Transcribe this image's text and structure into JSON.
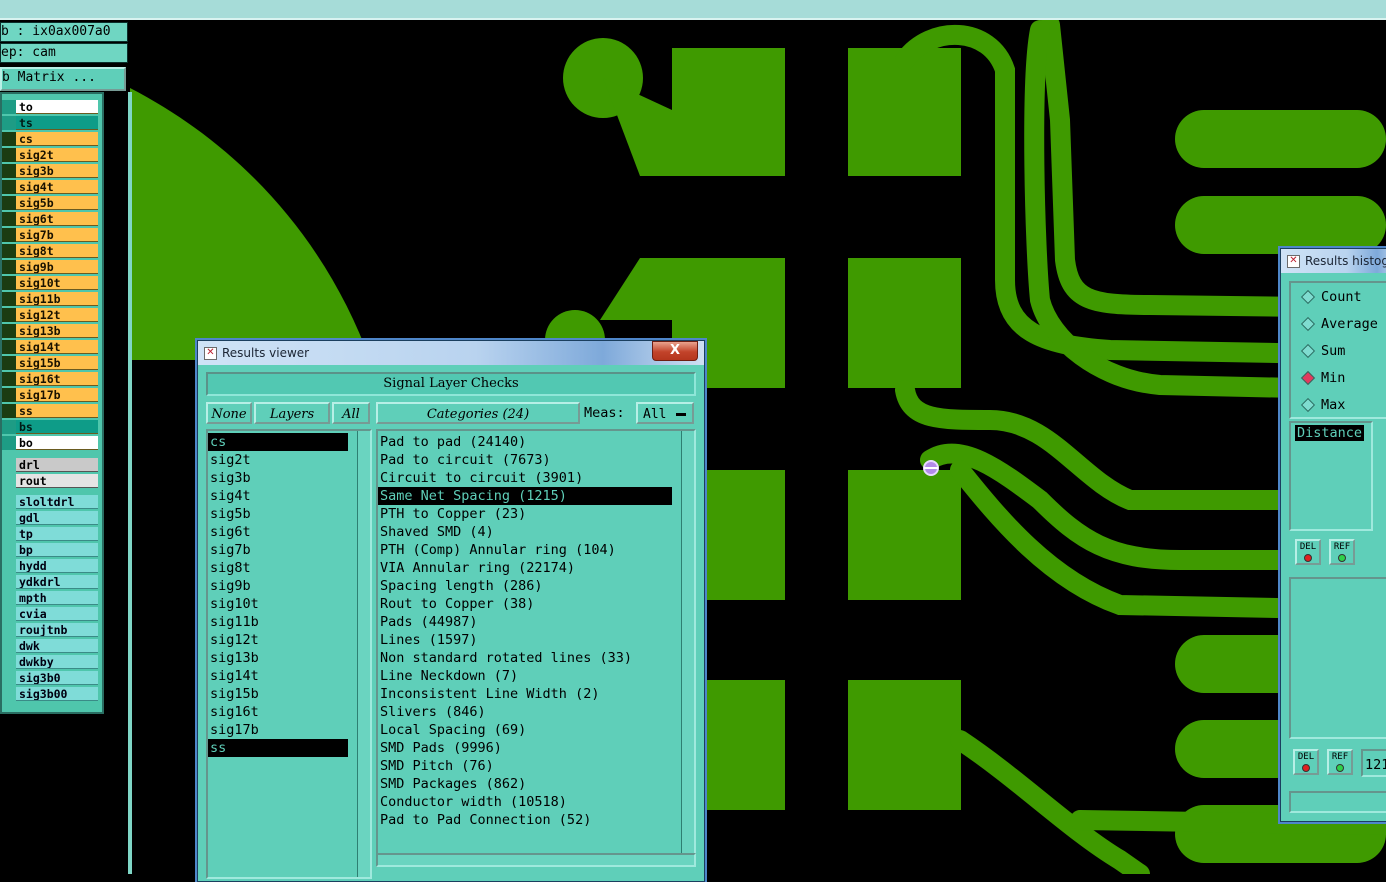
{
  "left_panel": {
    "job": "b : ix0ax007a0",
    "step": "ep: cam",
    "matrix_button": "b Matrix ...",
    "layers": [
      {
        "name": "to",
        "kind": "white",
        "mark": "◂"
      },
      {
        "name": "ts",
        "kind": "teal",
        "mark": ""
      },
      {
        "name": "cs",
        "kind": "orange",
        "mark": "▫"
      },
      {
        "name": "sig2t",
        "kind": "orange",
        "mark": ""
      },
      {
        "name": "sig3b",
        "kind": "orange",
        "mark": ""
      },
      {
        "name": "sig4t",
        "kind": "orange",
        "mark": ""
      },
      {
        "name": "sig5b",
        "kind": "orange",
        "mark": ""
      },
      {
        "name": "sig6t",
        "kind": "orange",
        "mark": ""
      },
      {
        "name": "sig7b",
        "kind": "orange",
        "mark": ""
      },
      {
        "name": "sig8t",
        "kind": "orange",
        "mark": ""
      },
      {
        "name": "sig9b",
        "kind": "orange",
        "mark": ""
      },
      {
        "name": "sig10t",
        "kind": "orange",
        "mark": ""
      },
      {
        "name": "sig11b",
        "kind": "orange",
        "mark": ""
      },
      {
        "name": "sig12t",
        "kind": "orange",
        "mark": ""
      },
      {
        "name": "sig13b",
        "kind": "orange",
        "mark": ""
      },
      {
        "name": "sig14t",
        "kind": "orange",
        "mark": ""
      },
      {
        "name": "sig15b",
        "kind": "orange",
        "mark": ""
      },
      {
        "name": "sig16t",
        "kind": "orange",
        "mark": ""
      },
      {
        "name": "sig17b",
        "kind": "orange",
        "mark": ""
      },
      {
        "name": "ss",
        "kind": "orange",
        "mark": ""
      },
      {
        "name": "bs",
        "kind": "teal",
        "mark": ""
      },
      {
        "name": "bo",
        "kind": "white",
        "mark": "◂"
      }
    ],
    "drill_layers": [
      {
        "name": "drl",
        "kind": "gray"
      },
      {
        "name": "rout",
        "kind": "gray2"
      }
    ],
    "misc_layers": [
      "sloltdrl",
      "gdl",
      "tp",
      "bp",
      "hydd",
      "ydkdrl",
      "mpth",
      "cvia",
      "roujtnb",
      "dwk",
      "dwkby",
      "sig3b0",
      "sig3b00"
    ]
  },
  "results_viewer": {
    "title": "Results viewer",
    "close": "X",
    "header": "Signal Layer Checks",
    "none_button": "None",
    "layers_button": "Layers",
    "all_button": "All",
    "categories_button": "Categories (24)",
    "meas_label": "Meas:",
    "meas_value": "All",
    "layers": [
      "cs",
      "sig2t",
      "sig3b",
      "sig4t",
      "sig5b",
      "sig6t",
      "sig7b",
      "sig8t",
      "sig9b",
      "sig10t",
      "sig11b",
      "sig12t",
      "sig13b",
      "sig14t",
      "sig15b",
      "sig16t",
      "sig17b",
      "ss"
    ],
    "selected_layers": [
      "cs",
      "ss"
    ],
    "categories": [
      "Pad to pad (24140)",
      "Pad to circuit (7673)",
      "Circuit to circuit (3901)",
      "Same Net Spacing (1215)",
      "PTH to Copper (23)",
      "Shaved SMD (4)",
      "PTH (Comp) Annular ring (104)",
      "VIA Annular ring (22174)",
      "Spacing length (286)",
      "Rout to Copper (38)",
      "Pads (44987)",
      "Lines (1597)",
      "Non standard rotated lines (33)",
      "Line Neckdown (7)",
      "Inconsistent Line Width (2)",
      "Slivers (846)",
      "Local Spacing (69)",
      "SMD Pads (9996)",
      "SMD Pitch (76)",
      "SMD Packages (862)",
      "Conductor width (10518)",
      "Pad to Pad Connection (52)"
    ],
    "selected_category": "Same Net Spacing (1215)"
  },
  "histogram": {
    "title": "Results histog",
    "options": [
      "Count",
      "Average",
      "Sum",
      "Min",
      "Max"
    ],
    "selected_option": "Min",
    "measure": "Distance",
    "del_label": "DEL",
    "ref_label": "REF",
    "value_fragment": "121"
  },
  "colors": {
    "copper": "#3f9a00",
    "background": "#000000",
    "panel": "#5fcfb9",
    "orange_layer": "#ffc04d",
    "marker": "#b38be8"
  }
}
